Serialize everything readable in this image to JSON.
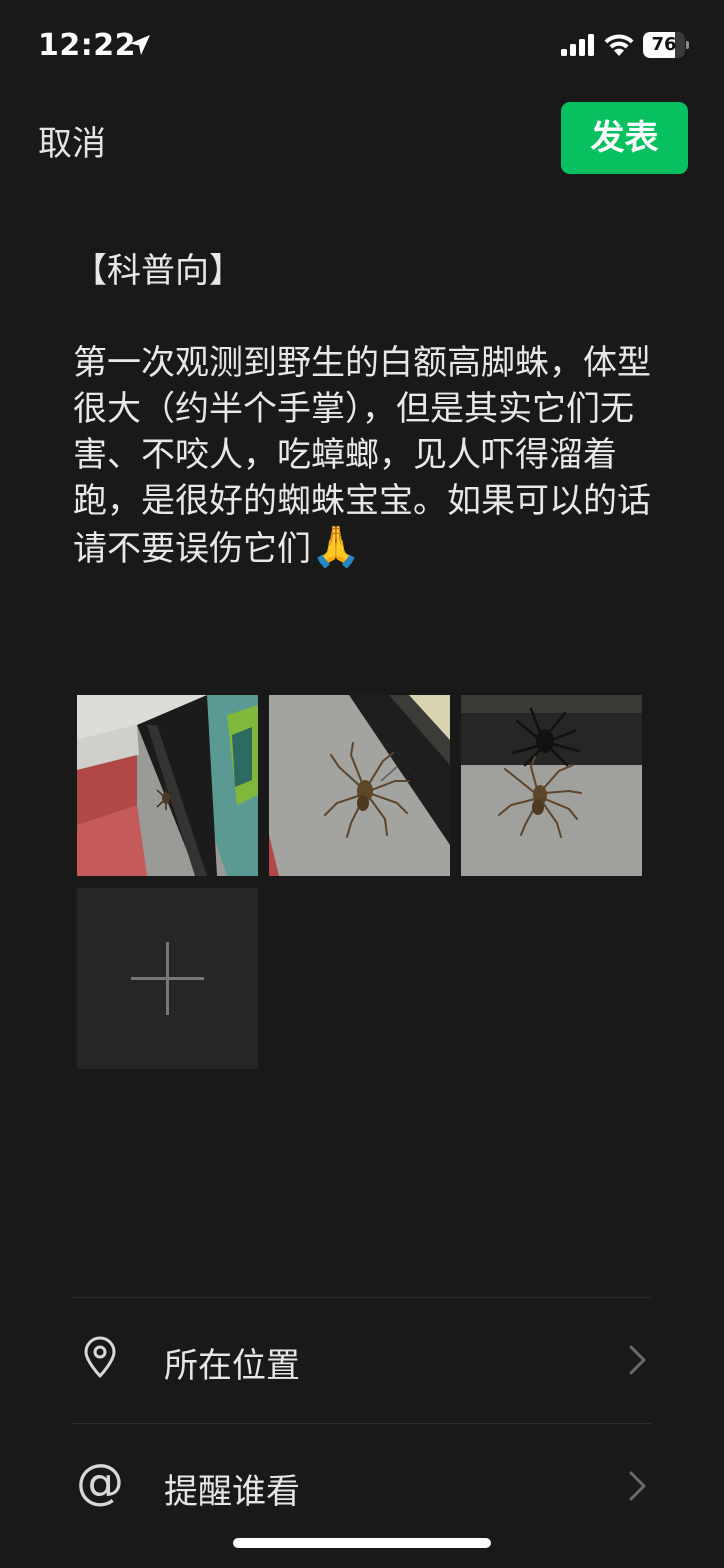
{
  "status_bar": {
    "time": "12:22",
    "battery_level": "76",
    "battery_fraction": 0.76,
    "icons": [
      "location-arrow-icon",
      "cellular-signal-icon",
      "wifi-icon",
      "battery-icon"
    ]
  },
  "header": {
    "cancel_label": "取消",
    "publish_label": "发表",
    "accent_color": "#07c160"
  },
  "post": {
    "heading": "【科普向】",
    "body": "第一次观测到野生的白额高脚蛛，体型很大（约半个手掌），但是其实它们无害、不咬人，吃蟑螂，见人吓得溜着跑，是很好的蜘蛛宝宝。如果可以的话请不要误伤它们",
    "emoji": "🙏"
  },
  "photos": [
    {
      "name": "photo-spider-near-doorframe"
    },
    {
      "name": "photo-spider-on-floor-closeup"
    },
    {
      "name": "photo-spider-with-shadow"
    }
  ],
  "add_photo_icon": "plus-icon",
  "options": [
    {
      "label": "所在位置",
      "icon": "location-pin-icon"
    },
    {
      "label": "提醒谁看",
      "icon": "at-icon"
    }
  ]
}
